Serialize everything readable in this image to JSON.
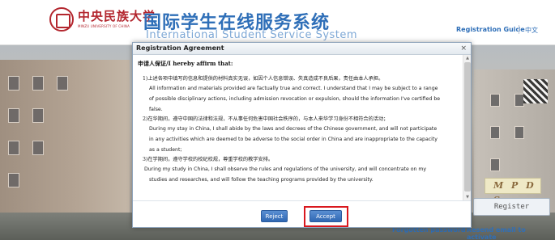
{
  "header": {
    "university_cn": "中央民族大学",
    "university_en": "MINZU UNIVERSITY OF CHINA",
    "system_cn": "国际学生在线服务系统",
    "system_en": "International Student Service System",
    "registration_guide": "Registration Guide",
    "language_toggle": "中文"
  },
  "login_panel": {
    "captcha_text": "M P D S",
    "register_label": "Register",
    "forgot_password": "Forgotten password",
    "resend_email": "Resend email to activate"
  },
  "modal": {
    "title": "Registration Agreement",
    "close_symbol": "×",
    "heading": "申请人保证/I hereby affirm that:",
    "clauses": [
      {
        "cn": "1)上述各项中填写的信息和提供的材料真实无误，如因个人信息错误、失真造成不良后果，责任由本人承担。",
        "en": [
          "All information and materials provided are factually true and correct. I understand that I may be subject to a range",
          "of possible disciplinary actions, including admission revocation or expulsion, should the information I've certified be",
          "false."
        ]
      },
      {
        "cn": "2)在华期间，遵守中国的法律和法规，不从事任何危害中国社会秩序的，与本人来华学习身份不相符合的活动；",
        "en": [
          "During my stay in China, I shall abide by the laws and decrees of the Chinese government, and will not participate",
          "in any activities which are deemed to be adverse to the social order in China and are inappropriate to the capacity",
          "as a student;"
        ]
      },
      {
        "cn": "3)在学期间，遵守学校的校纪校规，尊重学校的教学安排。",
        "en": [
          "During my study in China, I shall observe the rules and regulations of the university, and will concentrate on my",
          "studies and researches, and will follow the teaching programs provided by the university."
        ]
      }
    ],
    "reject_label": "Reject",
    "accept_label": "Accept"
  },
  "colors": {
    "brand_red": "#b3262e",
    "brand_blue": "#2f6fb8",
    "button_blue": "#2f67b3",
    "highlight_red": "#d9181e"
  }
}
